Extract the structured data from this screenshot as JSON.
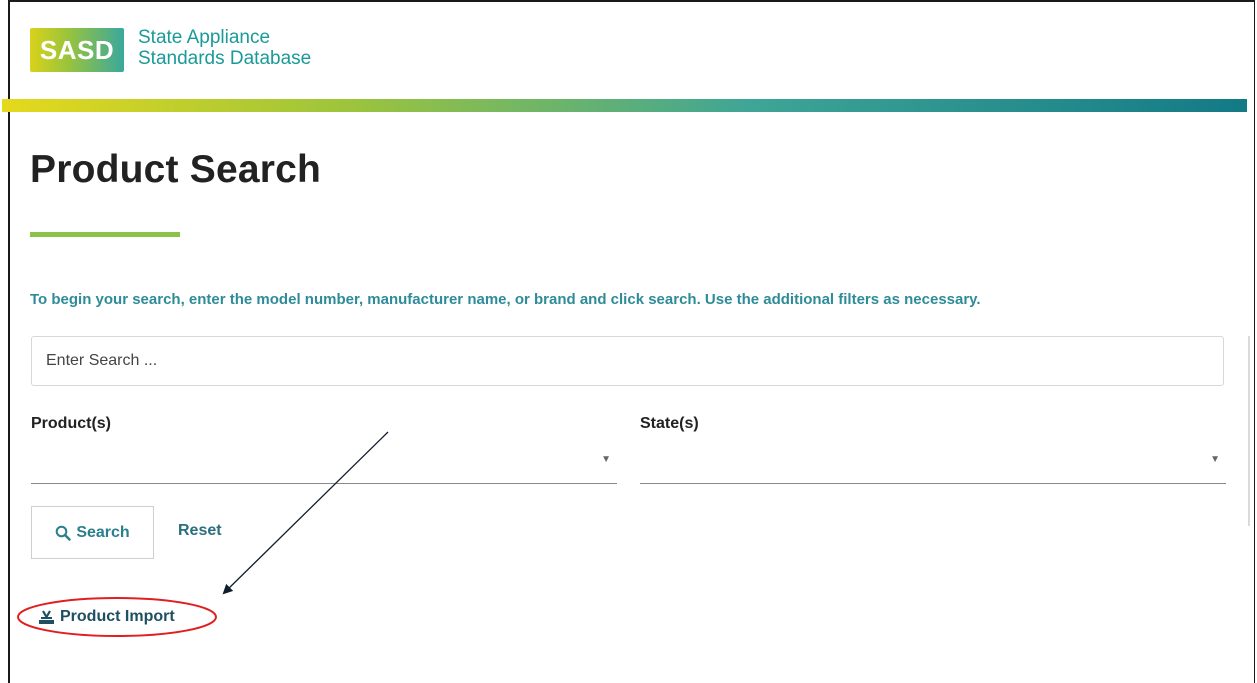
{
  "header": {
    "logo_abbr": "SASD",
    "logo_line1": "State Appliance",
    "logo_line2": "Standards Database"
  },
  "page": {
    "title": "Product Search",
    "instructions": "To begin your search, enter the model number, manufacturer name, or brand and click search. Use the additional filters as necessary."
  },
  "search": {
    "placeholder": "Enter Search ...",
    "value": ""
  },
  "filters": {
    "product_label": "Product(s)",
    "state_label": "State(s)",
    "product_value": "",
    "state_value": ""
  },
  "actions": {
    "search_label": "Search",
    "reset_label": "Reset",
    "import_label": "Product Import"
  },
  "icons": {
    "search": "search-icon",
    "import": "import-icon",
    "dropdown": "dropdown-arrow-icon"
  },
  "colors": {
    "accent_teal": "#2e8c99",
    "link_dark": "#1e4f63",
    "underline_green": "#8bc34a",
    "annotation_red": "#e02020"
  }
}
